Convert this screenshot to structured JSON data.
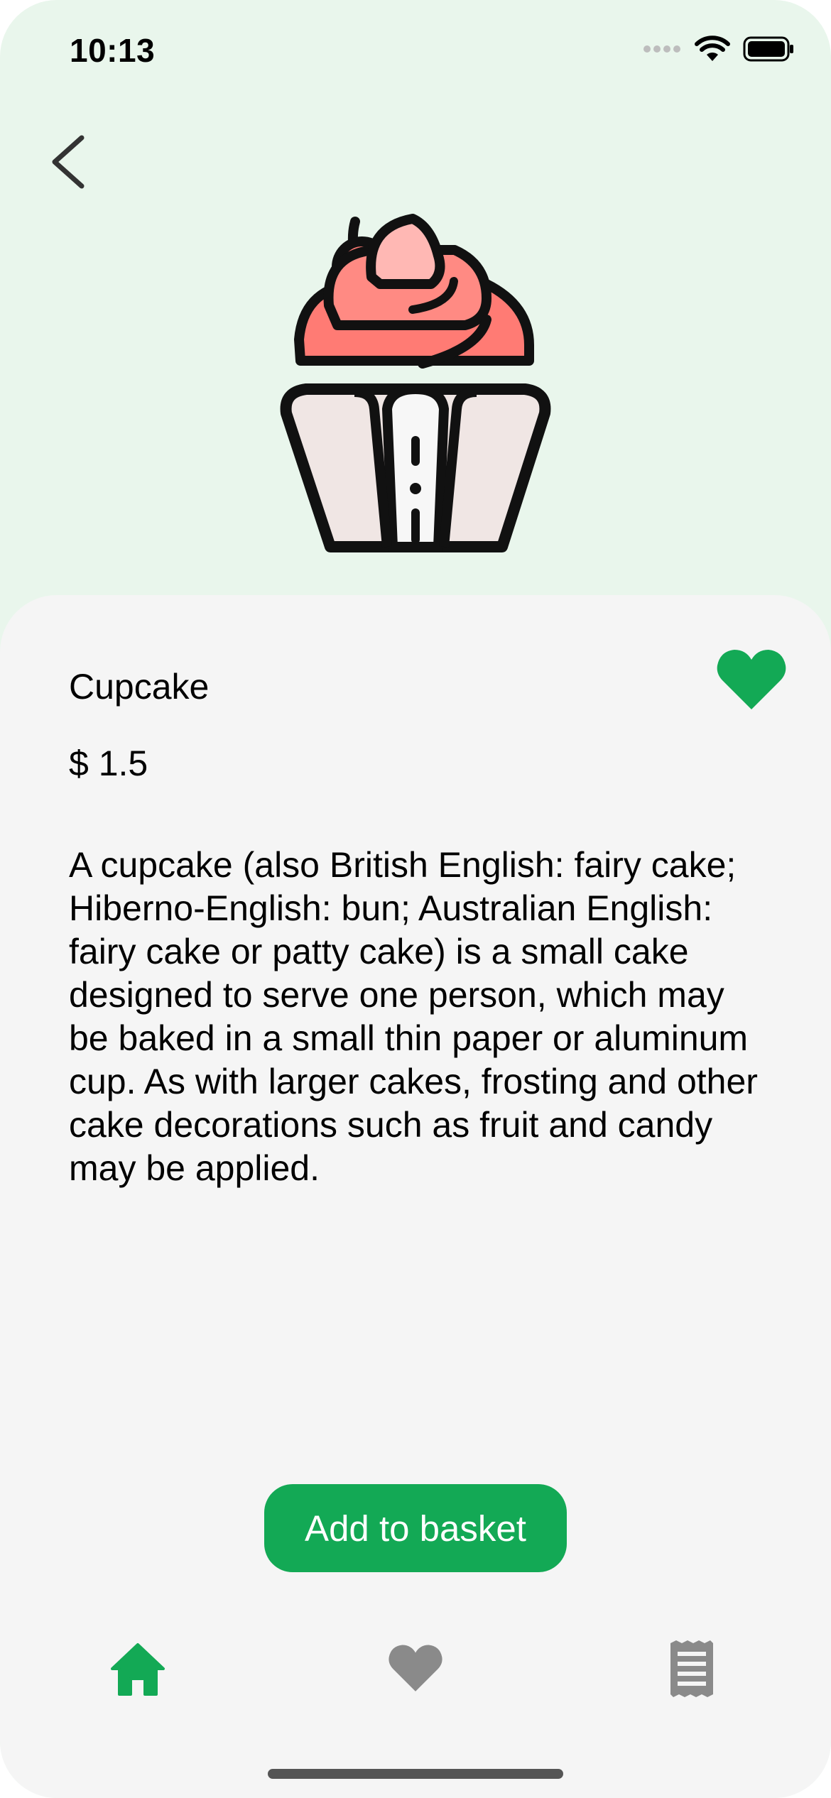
{
  "status_bar": {
    "time": "10:13",
    "icons": [
      "signal-icon",
      "wifi-icon",
      "battery-icon"
    ]
  },
  "nav": {
    "back_icon": "chevron-left-icon"
  },
  "product": {
    "image_icon": "cupcake-icon",
    "name": "Cupcake",
    "price": "$ 1.5",
    "favorite": true,
    "description": "A cupcake (also British English: fairy cake; Hiberno-English: bun; Australian English: fairy cake or patty cake) is a small cake designed to serve one person, which may be baked in a small thin paper or aluminum cup. As with larger cakes, frosting and other cake decorations such as fruit and candy may be applied."
  },
  "actions": {
    "add_to_basket": "Add to basket"
  },
  "tabbar": {
    "items": [
      {
        "icon": "home-icon",
        "active": true
      },
      {
        "icon": "heart-icon",
        "active": false
      },
      {
        "icon": "receipt-icon",
        "active": false
      }
    ]
  },
  "colors": {
    "accent": "#13a955",
    "header_background": "#e9f6ec",
    "sheet_background": "#f5f5f5",
    "inactive_icon": "#8a8a8a"
  }
}
